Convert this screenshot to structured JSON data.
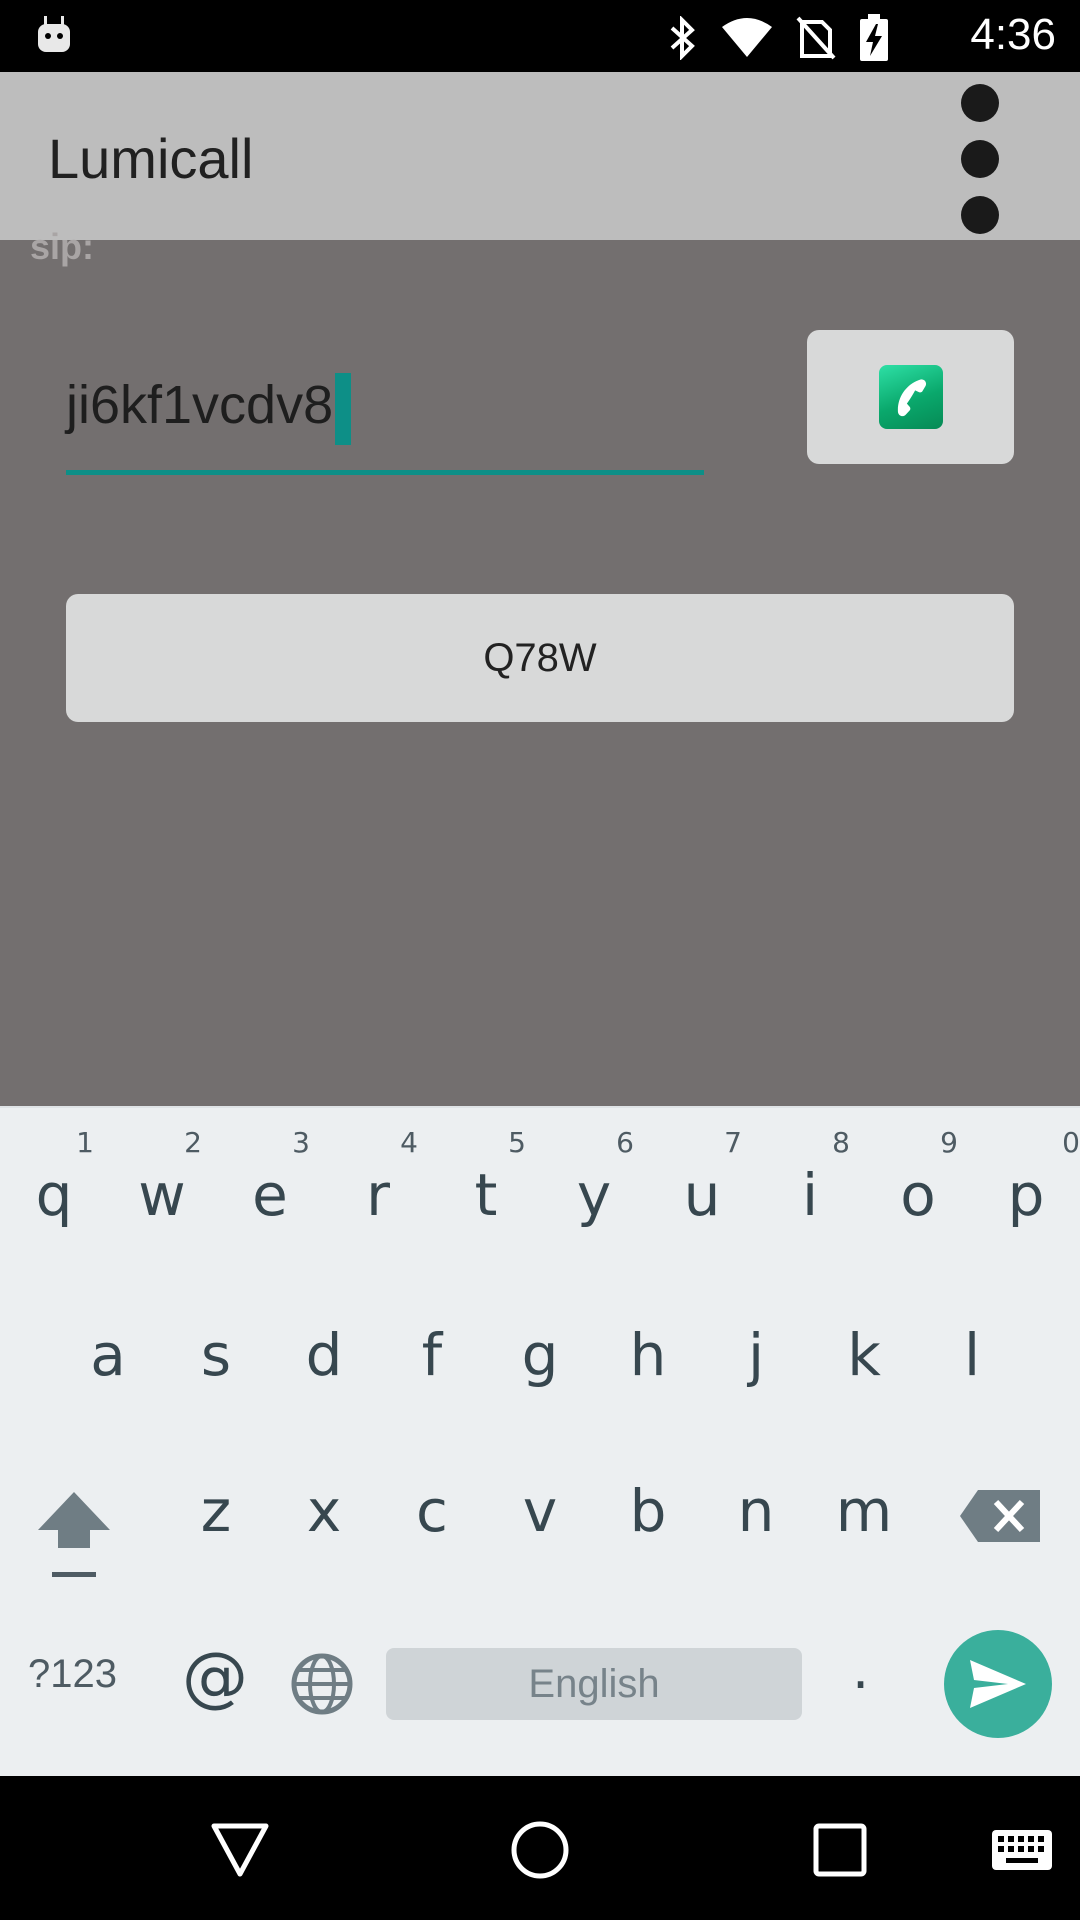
{
  "status_bar": {
    "time": "4:36",
    "icons": [
      "android-debug-icon",
      "bluetooth-icon",
      "wifi-icon",
      "no-sim-icon",
      "battery-charging-icon"
    ]
  },
  "app_bar": {
    "title": "Lumicall",
    "menu_icon": "overflow-menu-icon"
  },
  "form": {
    "scheme_label": "sip:",
    "uri_value": "ji6kf1vcdv8",
    "call_button_icon": "phone-icon",
    "code_button_label": "Q78W"
  },
  "keyboard": {
    "row1": [
      {
        "key": "q",
        "hint": "1"
      },
      {
        "key": "w",
        "hint": "2"
      },
      {
        "key": "e",
        "hint": "3"
      },
      {
        "key": "r",
        "hint": "4"
      },
      {
        "key": "t",
        "hint": "5"
      },
      {
        "key": "y",
        "hint": "6"
      },
      {
        "key": "u",
        "hint": "7"
      },
      {
        "key": "i",
        "hint": "8"
      },
      {
        "key": "o",
        "hint": "9"
      },
      {
        "key": "p",
        "hint": "0"
      }
    ],
    "row2": [
      "a",
      "s",
      "d",
      "f",
      "g",
      "h",
      "j",
      "k",
      "l"
    ],
    "row3": [
      "z",
      "x",
      "c",
      "v",
      "b",
      "n",
      "m"
    ],
    "symbols_label": "?123",
    "at_label": "@",
    "space_label": "English",
    "period_label": ".",
    "icons": [
      "shift-icon",
      "backspace-icon",
      "globe-icon",
      "send-icon"
    ]
  },
  "nav_bar": {
    "icons": [
      "back-icon",
      "home-icon",
      "recents-icon",
      "keyboard-icon"
    ]
  },
  "colors": {
    "app_bar": "#bdbdbd",
    "content_bg": "#736f6f",
    "accent": "#0d8f87",
    "button_bg": "#d8d9d9",
    "keyboard_bg": "#eceff1",
    "enter_key": "#3aaf9c"
  }
}
